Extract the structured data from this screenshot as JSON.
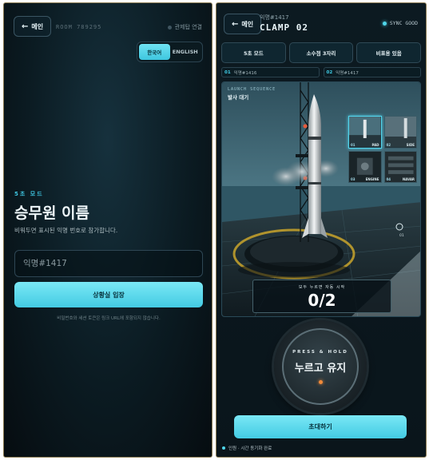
{
  "lobby": {
    "back_label": "메인",
    "room_label": "ROOM 789295",
    "spectator_label": "관제탑 연결",
    "languages": [
      "한국어",
      "ENGLISH"
    ],
    "active_language": "한국어",
    "mode_label": "5초 모드",
    "title": "승무원 이름",
    "subtitle": "비워두면 표시된 익명 번호로 참가합니다.",
    "name_placeholder": "익명#1417",
    "enter_label": "상황실 입장",
    "note": "비밀번호와 세션 토큰은 링크 URL에 포함되지 않습니다."
  },
  "game": {
    "back_label": "메인",
    "player_tag": "익명#1417",
    "title": "CLAMP 02",
    "sync_label": "SYNC GOOD",
    "options": [
      "5초 모드",
      "소수점 3자리",
      "비표용 있음"
    ],
    "slots": [
      {
        "num": "01",
        "name": "익명#1416"
      },
      {
        "num": "02",
        "name": "익명#1417"
      }
    ],
    "scene": {
      "sequence_label": "LAUNCH SEQUENCE",
      "state_label": "발사 대기",
      "cameras": [
        {
          "id": "01",
          "name": "PAD"
        },
        {
          "id": "02",
          "name": "SIDE"
        },
        {
          "id": "03",
          "name": "ENGINE"
        },
        {
          "id": "04",
          "name": "NAVAR"
        }
      ],
      "cam_id_label": "01",
      "count_label": "모두 누르면 자동 시작",
      "count_value": "0/2"
    },
    "hold": {
      "en": "PRESS & HOLD",
      "ko": "누르고 유지"
    },
    "invite_label": "초대하기",
    "status_text": "인원 · 시간 동기화 완료"
  },
  "colors": {
    "accent": "#43cbe3",
    "frame": "#8a7a52",
    "hold_indicator": "#f08a3a"
  },
  "icons": [
    "back-arrow-icon",
    "status-dot-icon",
    "sync-dot-icon"
  ]
}
